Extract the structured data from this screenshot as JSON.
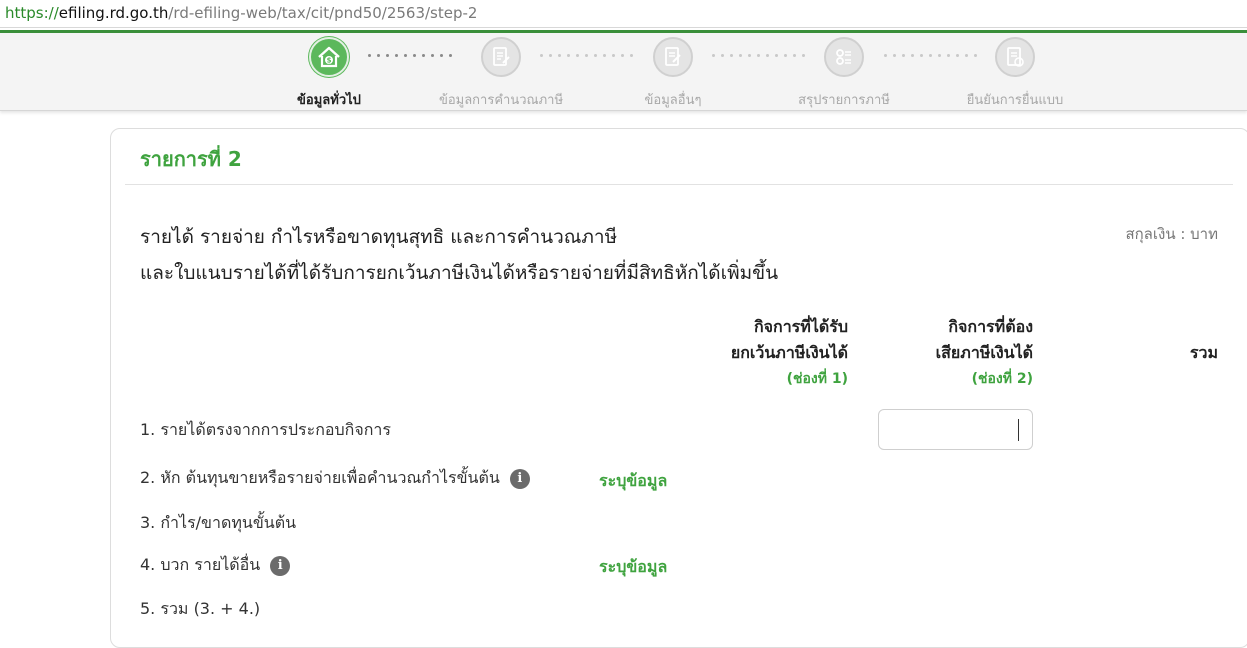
{
  "browser": {
    "url_scheme": "https://",
    "url_host": "efiling.rd.go.th",
    "url_path": "/rd-efiling-web/tax/cit/pnd50/2563/step-2"
  },
  "stepper": {
    "steps": [
      {
        "label": "ข้อมูลทั่วไป",
        "icon": "house-money-icon",
        "state": "active"
      },
      {
        "label": "ข้อมูลการคำนวณภาษี",
        "icon": "calculator-document-icon",
        "state": "inactive"
      },
      {
        "label": "ข้อมูลอื่นๆ",
        "icon": "document-edit-icon",
        "state": "inactive"
      },
      {
        "label": "สรุปรายการภาษี",
        "icon": "calculator-icon",
        "state": "inactive"
      },
      {
        "label": "ยืนยันการยื่นแบบ",
        "icon": "document-confirm-icon",
        "state": "inactive"
      }
    ]
  },
  "card": {
    "title": "รายการที่ 2",
    "heading_line1": "รายได้ รายจ่าย กำไรหรือขาดทุนสุทธิ และการคำนวณภาษี",
    "heading_line2": "และใบแนบรายได้ที่ได้รับการยกเว้นภาษีเงินได้หรือรายจ่ายที่มีสิทธิหักได้เพิ่มขึ้น",
    "currency": "สกุลเงิน : บาท"
  },
  "columns": {
    "exempt_line1": "กิจการที่ได้รับ",
    "exempt_line2": "ยกเว้นภาษีเงินได้",
    "exempt_sub": "(ช่องที่ 1)",
    "taxable_line1": "กิจการที่ต้อง",
    "taxable_line2": "เสียภาษีเงินได้",
    "taxable_sub": "(ช่องที่ 2)",
    "total": "รวม"
  },
  "rows": [
    {
      "label": "1. รายได้ตรงจากการประกอบกิจการ"
    },
    {
      "label": "2. หัก ต้นทุนขายหรือรายจ่ายเพื่อคำนวณกำไรขั้นต้น",
      "info_icon": "i",
      "link": "ระบุข้อมูล"
    },
    {
      "label": "3. กำไร/ขาดทุนขั้นต้น"
    },
    {
      "label": "4. บวก รายได้อื่น",
      "info_icon": "i",
      "link": "ระบุข้อมูล"
    },
    {
      "label": "5. รวม (3. + 4.)"
    }
  ],
  "row1_input": {
    "value": ""
  },
  "colors": {
    "accent_green": "#3fa33f",
    "active_step": "#5cb85c",
    "inactive_step": "#e4e4e4"
  }
}
